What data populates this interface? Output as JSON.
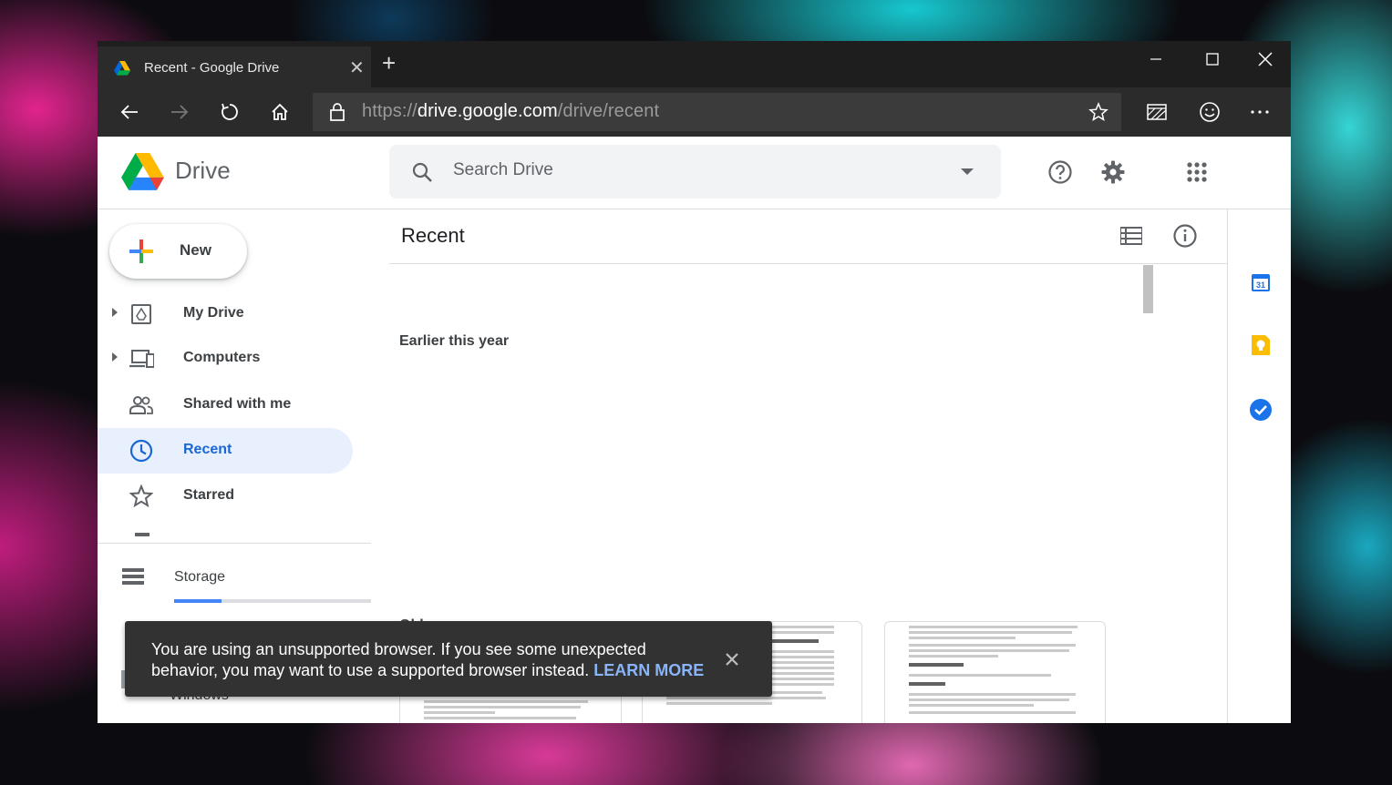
{
  "browser": {
    "tab_title": "Recent - Google Drive",
    "url_prefix": "https://",
    "url_host": "drive.google.com",
    "url_path": "/drive/recent"
  },
  "drive": {
    "logo_text": "Drive",
    "search_placeholder": "Search Drive",
    "new_label": "New",
    "nav": [
      {
        "label": "My Drive",
        "icon": "my-drive-icon"
      },
      {
        "label": "Computers",
        "icon": "computers-icon"
      },
      {
        "label": "Shared with me",
        "icon": "shared-icon"
      },
      {
        "label": "Recent",
        "icon": "clock-icon",
        "active": true
      },
      {
        "label": "Starred",
        "icon": "star-icon"
      }
    ],
    "storage_label": "Storage",
    "storage_used_fraction": 0.24,
    "main_title": "Recent",
    "sections": [
      "Earlier this year",
      "Older"
    ],
    "peek_text": "Windows"
  },
  "toast": {
    "message": "You are using an unsupported browser. If you see some unexpected behavior, you may want to use a supported browser instead.",
    "link": "LEARN MORE"
  },
  "colors": {
    "accent": "#1967d2",
    "active_bg": "#e8f0fe",
    "toast_bg": "#323232",
    "toast_link": "#8ab4f8"
  }
}
